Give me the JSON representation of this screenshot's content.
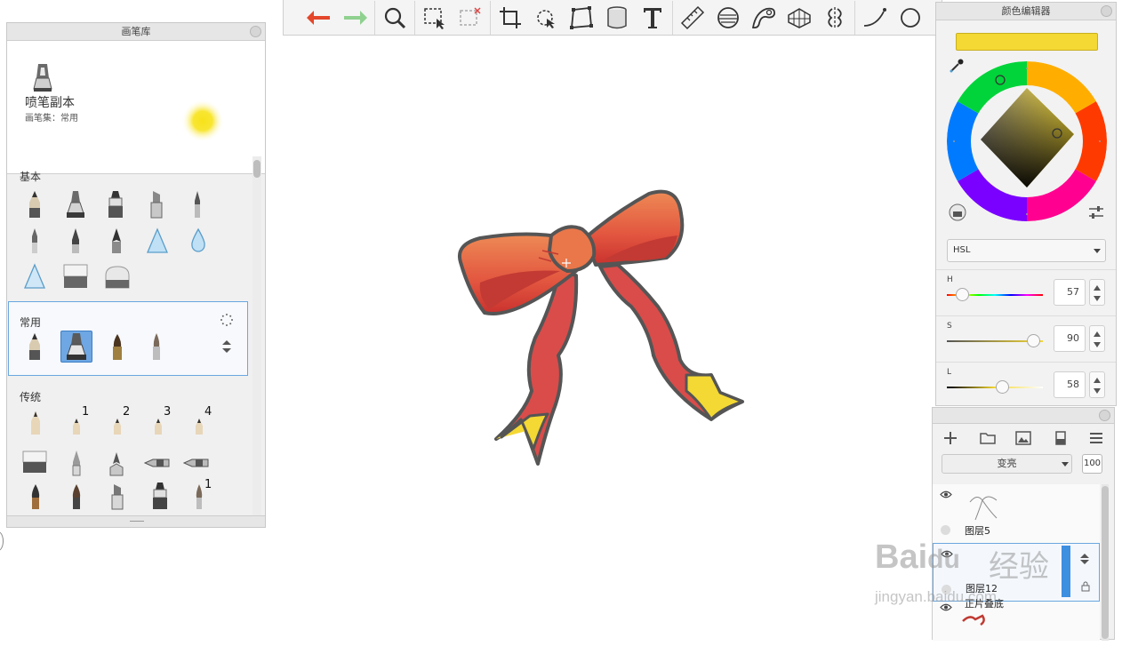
{
  "brush_library": {
    "title": "画笔库",
    "current_brush_name": "喷笔副本",
    "current_brush_set": "画笔集：常用",
    "sections": [
      {
        "label": "基本"
      },
      {
        "label": "常用"
      },
      {
        "label": "传统"
      }
    ],
    "numbered_labels": [
      "1",
      "2",
      "3",
      "4"
    ],
    "last_row_number": "1"
  },
  "color_editor": {
    "title": "颜色编辑器",
    "current_color": "#f4d833",
    "mode": "HSL",
    "h_label": "H",
    "s_label": "S",
    "l_label": "L",
    "h_value": "57",
    "s_value": "90",
    "l_value": "58",
    "h_fraction": 0.16,
    "s_fraction": 0.9,
    "l_fraction": 0.58
  },
  "layers": {
    "blend_mode": "变亮",
    "opacity": "100",
    "items": [
      {
        "name": "图层5"
      },
      {
        "name": "图层12"
      },
      {
        "name": "正片叠底"
      }
    ]
  },
  "watermark": {
    "logo_text": "Bai",
    "logo_text_2": "du",
    "brand": "经验",
    "url": "jingyan.baidu.com"
  },
  "colors": {
    "undo": "#e4472b",
    "redo": "#7ccb7c",
    "ribbon_red": "#d94c4a",
    "ribbon_yellow": "#f4d833"
  },
  "icons": [
    "undo-icon",
    "redo-icon",
    "zoom-icon",
    "rect-select-icon",
    "freeform-select-icon",
    "crop-icon",
    "transform-icon",
    "perspective-icon",
    "fill-bucket-icon",
    "text-icon",
    "ruler-icon",
    "ellipse-guide-icon",
    "french-curve-icon",
    "perspective-grid-icon",
    "symmetry-icon",
    "stroke-icon",
    "ellipse-icon"
  ]
}
